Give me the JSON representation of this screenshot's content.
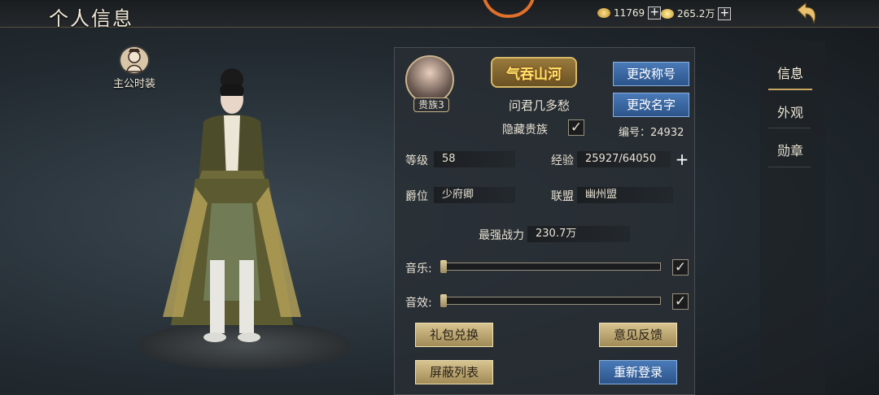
{
  "header": {
    "title": "个人信息",
    "currency1": "11769",
    "currency2": "265.2万"
  },
  "costume": {
    "label": "主公时装"
  },
  "profile": {
    "rank_badge": "贵族3",
    "title_badge": "气吞山河",
    "name": "问君几多愁",
    "hide_noble_label": "隐藏贵族",
    "hide_noble_checked": true,
    "change_title_btn": "更改称号",
    "change_name_btn": "更改名字",
    "id_text": "编号：24932"
  },
  "stats": {
    "level_label": "等级",
    "level_value": "58",
    "exp_label": "经验",
    "exp_value": "25927/64050",
    "peerage_label": "爵位",
    "peerage_value": "少府卿",
    "alliance_label": "联盟",
    "alliance_value": "幽州盟",
    "power_label": "最强战力",
    "power_value": "230.7万"
  },
  "settings": {
    "music_label": "音乐:",
    "music_checked": true,
    "sfx_label": "音效:",
    "sfx_checked": true
  },
  "buttons": {
    "gift_code": "礼包兑换",
    "feedback": "意见反馈",
    "block_list": "屏蔽列表",
    "relogin": "重新登录"
  },
  "nav": {
    "items": [
      "信息",
      "外观",
      "勋章"
    ]
  },
  "colors": {
    "accent_gold": "#c8a860",
    "button_blue": "#3a66a0",
    "title_orange": "#e0702a"
  }
}
